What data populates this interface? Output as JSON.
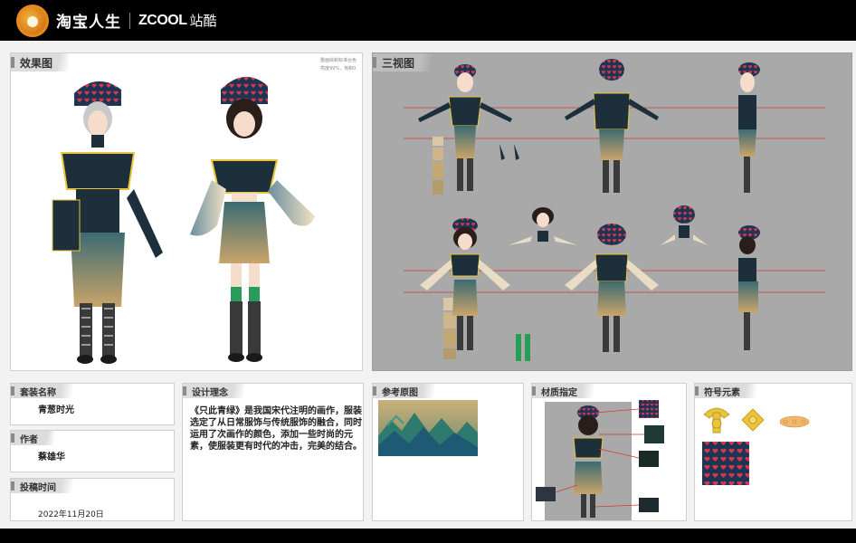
{
  "brand": {
    "name": "淘宝人生",
    "partner_logo": "ZCOOL",
    "partner_name": "站酷"
  },
  "panels": {
    "effect": {
      "title": "效果图",
      "note_line1": "整画绘制标准台色",
      "note_line2": "亮度99%，饱和0"
    },
    "three_view": {
      "title": "三视图"
    },
    "suit_name": {
      "title": "套装名称",
      "value": "青葱时光"
    },
    "author": {
      "title": "作者",
      "value": "蔡雄华"
    },
    "submit_time": {
      "title": "投稿时间",
      "value": "2022年11月20日"
    },
    "concept": {
      "title": "设计理念",
      "text": "《只此青绿》是我国宋代注明的画作，服装选定了从日常服饰与传统服饰的融合，同时运用了次画作的颜色，添加一些时尚的元素，使服装更有时代的冲击，完美的结合。"
    },
    "reference": {
      "title": "参考原图"
    },
    "material": {
      "title": "材质指定"
    },
    "symbol": {
      "title": "符号元素"
    }
  },
  "colors": {
    "jacket": "#1d2f3a",
    "trim": "#e8c53a",
    "skirt_top": "#3c6b72",
    "skirt_bottom": "#c9a46a",
    "hat": "#1c3555",
    "heart": "#d8374a",
    "boot_green": "#2a9c5a",
    "guide_red": "#d23a3a",
    "three_view_bg": "#a9a9a9"
  }
}
